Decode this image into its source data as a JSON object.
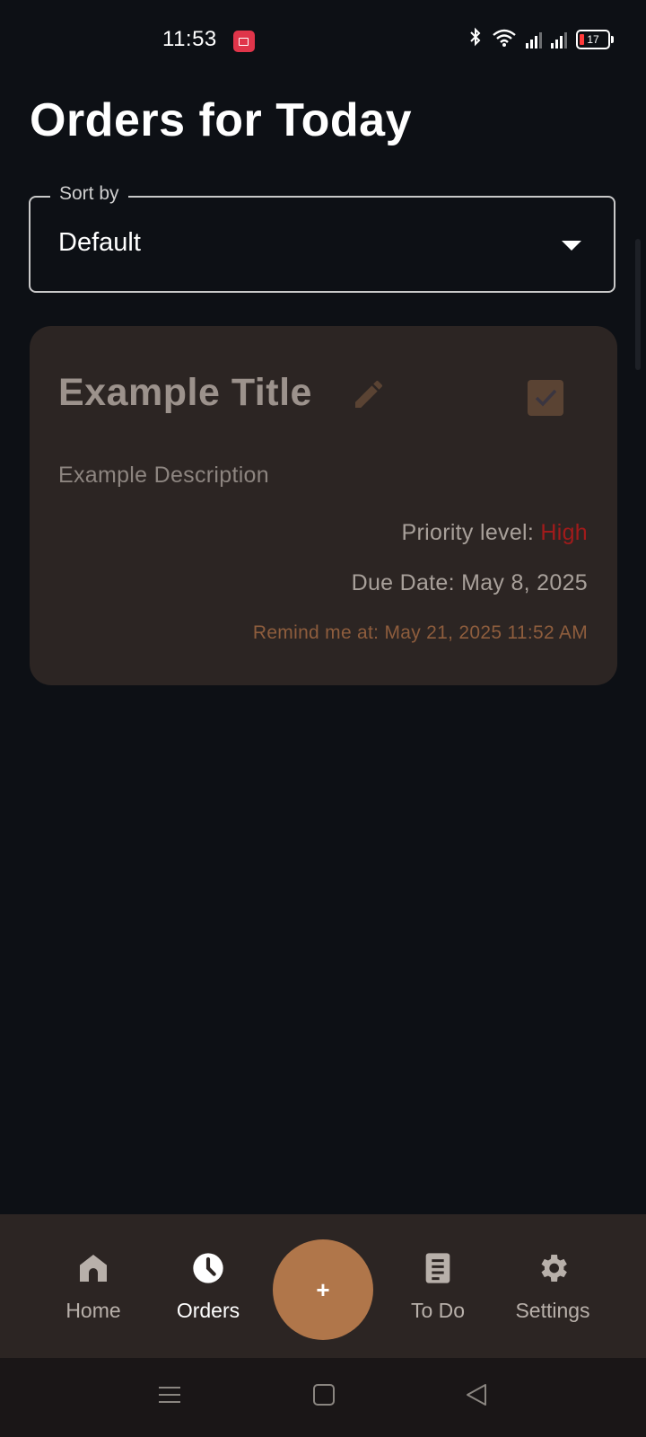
{
  "status_bar": {
    "time": "11:53",
    "battery": "17",
    "icons": [
      "screen-record-icon",
      "bluetooth-icon",
      "wifi-icon",
      "signal-icon",
      "signal-icon",
      "battery-icon"
    ]
  },
  "page": {
    "title": "Orders for Today"
  },
  "sort": {
    "label": "Sort by",
    "value": "Default"
  },
  "orders": [
    {
      "title": "Example Title",
      "description": "Example Description",
      "priority_label": "Priority level:",
      "priority_value": "High",
      "due_date": "Due Date: May 8, 2025",
      "reminder": "Remind me at: May 21, 2025 11:52 AM",
      "completed": true
    }
  ],
  "bottom_nav": {
    "items": [
      {
        "label": "Home",
        "icon": "home-icon"
      },
      {
        "label": "Orders",
        "icon": "clock-icon",
        "active": true
      },
      {
        "label": "To Do",
        "icon": "document-icon"
      },
      {
        "label": "Settings",
        "icon": "gear-icon"
      }
    ],
    "fab_label": "+"
  },
  "colors": {
    "background": "#0d1015",
    "card": "#2c2523",
    "accent": "#b0764a",
    "priority_high": "#a11b1b"
  }
}
